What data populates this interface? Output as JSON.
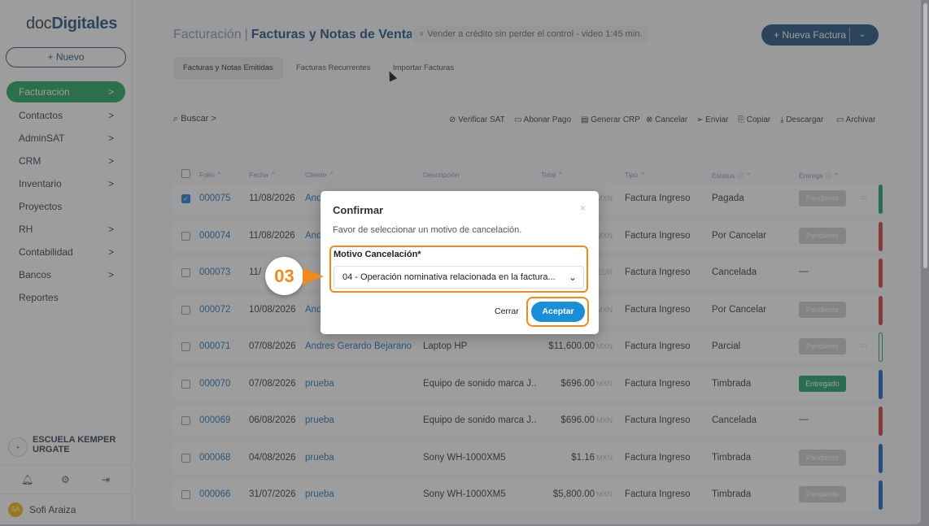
{
  "app": {
    "logo_prefix": "doc",
    "logo_brand": "Digitales",
    "new_button": "+ Nuevo"
  },
  "sidebar": {
    "items": [
      {
        "label": "Facturación",
        "chevron": ">"
      },
      {
        "label": "Contactos",
        "chevron": ">"
      },
      {
        "label": "AdminSAT",
        "chevron": ">"
      },
      {
        "label": "CRM",
        "chevron": ">"
      },
      {
        "label": "Inventario",
        "chevron": ">"
      },
      {
        "label": "Proyectos",
        "chevron": ""
      },
      {
        "label": "RH",
        "chevron": ">"
      },
      {
        "label": "Contabilidad",
        "chevron": ">"
      },
      {
        "label": "Bancos",
        "chevron": ">"
      },
      {
        "label": "Reportes",
        "chevron": ""
      }
    ],
    "company_line1": "ESCUELA KEMPER",
    "company_line2": "URGATE",
    "user_initials": "SA",
    "user_name": "Sofi Araiza"
  },
  "header": {
    "breadcrumb_root": "Facturación",
    "separator": "|",
    "page_title": "Facturas y Notas de Venta",
    "tip": "♀ Vender a crédito sin perder el control - video 1:45 min.",
    "new_invoice": "+ Nueva Factura"
  },
  "tabs": [
    "Facturas y Notas Emitidas",
    "Facturas Recurrentes",
    "Importar Facturas"
  ],
  "toolbar": {
    "search": "⌕ Buscar >",
    "actions": [
      "⊘ Verificar SAT",
      "▭ Abonar Pago",
      "▤ Generar CRP",
      "⊗ Cancelar",
      "➢ Enviar",
      "⎘ Copiar",
      "⤓ Descargar",
      "▭ Archivar"
    ]
  },
  "table": {
    "headers": [
      "Folio ⌃",
      "Fecha ⌃",
      "Cliente ⌃",
      "Descripción",
      "Total ⌃",
      "Tipo ⌃",
      "Estatus ⓘ ⌃",
      "Entrega ⓘ ⌃"
    ],
    "rows": [
      {
        "folio": "000075",
        "fecha": "11/08/2026",
        "cliente": "And",
        "desc": "",
        "total": "",
        "cur": "MXN",
        "tipo": "Factura Ingreso",
        "estatus": "Pagada",
        "entrega": "Pendiente"
      },
      {
        "folio": "000074",
        "fecha": "11/08/2026",
        "cliente": "And",
        "desc": "",
        "total": "",
        "cur": "MXN",
        "tipo": "Factura Ingreso",
        "estatus": "Por Cancelar",
        "entrega": "Pendiente"
      },
      {
        "folio": "000073",
        "fecha": "11/",
        "cliente": "",
        "desc": "",
        "total": "",
        "cur": "EUR",
        "tipo": "Factura Ingreso",
        "estatus": "Cancelada",
        "entrega": "—"
      },
      {
        "folio": "000072",
        "fecha": "10/08/2026",
        "cliente": "And",
        "desc": "",
        "total": "",
        "cur": "MXN",
        "tipo": "Factura Ingreso",
        "estatus": "Por Cancelar",
        "entrega": "Pendiente"
      },
      {
        "folio": "000071",
        "fecha": "07/08/2026",
        "cliente": "Andres Gerardo Bejarano ...",
        "desc": "Laptop HP",
        "total": "$11,600.00",
        "cur": "MXN",
        "tipo": "Factura Ingreso",
        "estatus": "Parcial",
        "entrega": "Pendiente"
      },
      {
        "folio": "000070",
        "fecha": "07/08/2026",
        "cliente": "prueba",
        "desc": "Equipo de sonido marca J...",
        "total": "$696.00",
        "cur": "MXN",
        "tipo": "Factura Ingreso",
        "estatus": "Timbrada",
        "entrega": "Entregado"
      },
      {
        "folio": "000069",
        "fecha": "06/08/2026",
        "cliente": "prueba",
        "desc": "Equipo de sonido marca J...",
        "total": "$696.00",
        "cur": "MXN",
        "tipo": "Factura Ingreso",
        "estatus": "Cancelada",
        "entrega": "—"
      },
      {
        "folio": "000068",
        "fecha": "04/08/2026",
        "cliente": "prueba",
        "desc": "Sony WH-1000XM5",
        "total": "$1.16",
        "cur": "MXN",
        "tipo": "Factura Ingreso",
        "estatus": "Timbrada",
        "entrega": "Pendiente"
      },
      {
        "folio": "000066",
        "fecha": "31/07/2026",
        "cliente": "prueba",
        "desc": "Sony WH-1000XM5",
        "total": "$5,800.00",
        "cur": "MXN",
        "tipo": "Factura Ingreso",
        "estatus": "Timbrada",
        "entrega": "Pendiente"
      }
    ]
  },
  "modal": {
    "title": "Confirmar",
    "close": "×",
    "message": "Favor de seleccionar un motivo de cancelación.",
    "field_label": "Motivo Cancelación*",
    "selected_value": "04 - Operación nominativa relacionada en la factura...",
    "cancel_label": "Cerrar",
    "accept_label": "Aceptar"
  },
  "annotation": {
    "step": "03",
    "color": "#f08a1c"
  }
}
